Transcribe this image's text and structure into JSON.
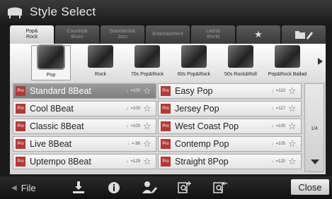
{
  "window": {
    "title": "Style Select"
  },
  "tabs": [
    {
      "label": "Pop&\nRock",
      "active": true
    },
    {
      "label": "Country&\nBlues",
      "active": false
    },
    {
      "label": "Standards&\nJazz",
      "active": false
    },
    {
      "label": "Entertainment",
      "active": false
    },
    {
      "label": "Latin&\nWorld",
      "active": false
    },
    {
      "label": "★",
      "active": false,
      "icon": "star-icon"
    },
    {
      "label": "",
      "active": false,
      "icon": "folder-edit-icon"
    }
  ],
  "categories": [
    {
      "label": "Pop",
      "active": true
    },
    {
      "label": "Rock",
      "active": false
    },
    {
      "label": "70s Pop&Rock",
      "active": false
    },
    {
      "label": "60s Pop&Rock",
      "active": false
    },
    {
      "label": "50s Rock&Roll",
      "active": false
    },
    {
      "label": "Pop&Rock Ballad",
      "active": false
    }
  ],
  "styles": [
    {
      "badge": "Pro",
      "name": "Standard 8Beat",
      "tempo": "♩=100",
      "selected": true
    },
    {
      "badge": "Pro",
      "name": "Cool 8Beat",
      "tempo": "♩=100",
      "selected": false
    },
    {
      "badge": "Pro",
      "name": "Classic 8Beat",
      "tempo": "♩=103",
      "selected": false
    },
    {
      "badge": "Pro",
      "name": "Live 8Beat",
      "tempo": "♩= 86",
      "selected": false
    },
    {
      "badge": "Pro",
      "name": "Uptempo 8Beat",
      "tempo": "♩=129",
      "selected": false
    },
    {
      "badge": "Pro",
      "name": "Easy Pop",
      "tempo": "♩=110",
      "selected": false
    },
    {
      "badge": "Pro",
      "name": "Jersey Pop",
      "tempo": "♩=117",
      "selected": false
    },
    {
      "badge": "Pro",
      "name": "West Coast Pop",
      "tempo": "♩=100",
      "selected": false
    },
    {
      "badge": "Pro",
      "name": "Contemp Pop",
      "tempo": "♩=105",
      "selected": false
    },
    {
      "badge": "Pro",
      "name": "Straight 8Pop",
      "tempo": "♩=120",
      "selected": false
    }
  ],
  "pager": {
    "page": "1/4"
  },
  "bottom": {
    "file_label": "File",
    "close_label": "Close",
    "icons": [
      "save-icon",
      "info-icon",
      "user-edit-icon",
      "search-add-icon",
      "search-back-icon"
    ]
  },
  "colors": {
    "pro_badge": "#b03a3a",
    "selected_row": "#8c8c8c"
  }
}
